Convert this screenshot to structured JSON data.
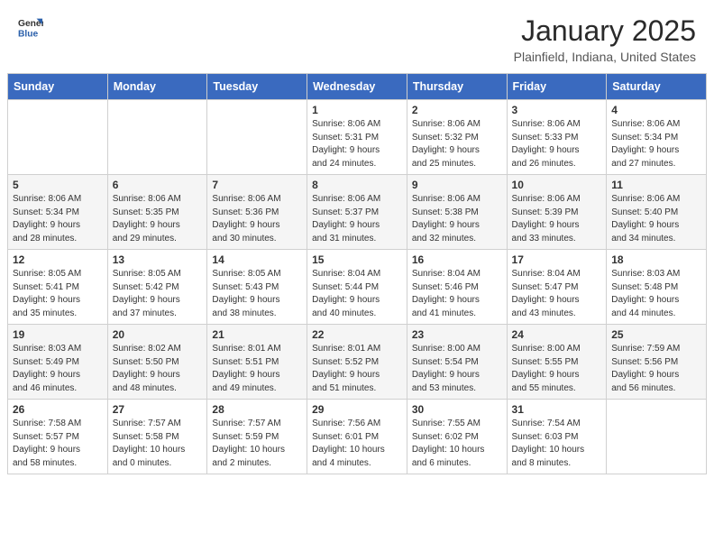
{
  "header": {
    "logo_general": "General",
    "logo_blue": "Blue",
    "month_title": "January 2025",
    "location": "Plainfield, Indiana, United States"
  },
  "days_of_week": [
    "Sunday",
    "Monday",
    "Tuesday",
    "Wednesday",
    "Thursday",
    "Friday",
    "Saturday"
  ],
  "weeks": [
    [
      {
        "day": "",
        "info": ""
      },
      {
        "day": "",
        "info": ""
      },
      {
        "day": "",
        "info": ""
      },
      {
        "day": "1",
        "info": "Sunrise: 8:06 AM\nSunset: 5:31 PM\nDaylight: 9 hours\nand 24 minutes."
      },
      {
        "day": "2",
        "info": "Sunrise: 8:06 AM\nSunset: 5:32 PM\nDaylight: 9 hours\nand 25 minutes."
      },
      {
        "day": "3",
        "info": "Sunrise: 8:06 AM\nSunset: 5:33 PM\nDaylight: 9 hours\nand 26 minutes."
      },
      {
        "day": "4",
        "info": "Sunrise: 8:06 AM\nSunset: 5:34 PM\nDaylight: 9 hours\nand 27 minutes."
      }
    ],
    [
      {
        "day": "5",
        "info": "Sunrise: 8:06 AM\nSunset: 5:34 PM\nDaylight: 9 hours\nand 28 minutes."
      },
      {
        "day": "6",
        "info": "Sunrise: 8:06 AM\nSunset: 5:35 PM\nDaylight: 9 hours\nand 29 minutes."
      },
      {
        "day": "7",
        "info": "Sunrise: 8:06 AM\nSunset: 5:36 PM\nDaylight: 9 hours\nand 30 minutes."
      },
      {
        "day": "8",
        "info": "Sunrise: 8:06 AM\nSunset: 5:37 PM\nDaylight: 9 hours\nand 31 minutes."
      },
      {
        "day": "9",
        "info": "Sunrise: 8:06 AM\nSunset: 5:38 PM\nDaylight: 9 hours\nand 32 minutes."
      },
      {
        "day": "10",
        "info": "Sunrise: 8:06 AM\nSunset: 5:39 PM\nDaylight: 9 hours\nand 33 minutes."
      },
      {
        "day": "11",
        "info": "Sunrise: 8:06 AM\nSunset: 5:40 PM\nDaylight: 9 hours\nand 34 minutes."
      }
    ],
    [
      {
        "day": "12",
        "info": "Sunrise: 8:05 AM\nSunset: 5:41 PM\nDaylight: 9 hours\nand 35 minutes."
      },
      {
        "day": "13",
        "info": "Sunrise: 8:05 AM\nSunset: 5:42 PM\nDaylight: 9 hours\nand 37 minutes."
      },
      {
        "day": "14",
        "info": "Sunrise: 8:05 AM\nSunset: 5:43 PM\nDaylight: 9 hours\nand 38 minutes."
      },
      {
        "day": "15",
        "info": "Sunrise: 8:04 AM\nSunset: 5:44 PM\nDaylight: 9 hours\nand 40 minutes."
      },
      {
        "day": "16",
        "info": "Sunrise: 8:04 AM\nSunset: 5:46 PM\nDaylight: 9 hours\nand 41 minutes."
      },
      {
        "day": "17",
        "info": "Sunrise: 8:04 AM\nSunset: 5:47 PM\nDaylight: 9 hours\nand 43 minutes."
      },
      {
        "day": "18",
        "info": "Sunrise: 8:03 AM\nSunset: 5:48 PM\nDaylight: 9 hours\nand 44 minutes."
      }
    ],
    [
      {
        "day": "19",
        "info": "Sunrise: 8:03 AM\nSunset: 5:49 PM\nDaylight: 9 hours\nand 46 minutes."
      },
      {
        "day": "20",
        "info": "Sunrise: 8:02 AM\nSunset: 5:50 PM\nDaylight: 9 hours\nand 48 minutes."
      },
      {
        "day": "21",
        "info": "Sunrise: 8:01 AM\nSunset: 5:51 PM\nDaylight: 9 hours\nand 49 minutes."
      },
      {
        "day": "22",
        "info": "Sunrise: 8:01 AM\nSunset: 5:52 PM\nDaylight: 9 hours\nand 51 minutes."
      },
      {
        "day": "23",
        "info": "Sunrise: 8:00 AM\nSunset: 5:54 PM\nDaylight: 9 hours\nand 53 minutes."
      },
      {
        "day": "24",
        "info": "Sunrise: 8:00 AM\nSunset: 5:55 PM\nDaylight: 9 hours\nand 55 minutes."
      },
      {
        "day": "25",
        "info": "Sunrise: 7:59 AM\nSunset: 5:56 PM\nDaylight: 9 hours\nand 56 minutes."
      }
    ],
    [
      {
        "day": "26",
        "info": "Sunrise: 7:58 AM\nSunset: 5:57 PM\nDaylight: 9 hours\nand 58 minutes."
      },
      {
        "day": "27",
        "info": "Sunrise: 7:57 AM\nSunset: 5:58 PM\nDaylight: 10 hours\nand 0 minutes."
      },
      {
        "day": "28",
        "info": "Sunrise: 7:57 AM\nSunset: 5:59 PM\nDaylight: 10 hours\nand 2 minutes."
      },
      {
        "day": "29",
        "info": "Sunrise: 7:56 AM\nSunset: 6:01 PM\nDaylight: 10 hours\nand 4 minutes."
      },
      {
        "day": "30",
        "info": "Sunrise: 7:55 AM\nSunset: 6:02 PM\nDaylight: 10 hours\nand 6 minutes."
      },
      {
        "day": "31",
        "info": "Sunrise: 7:54 AM\nSunset: 6:03 PM\nDaylight: 10 hours\nand 8 minutes."
      },
      {
        "day": "",
        "info": ""
      }
    ]
  ]
}
